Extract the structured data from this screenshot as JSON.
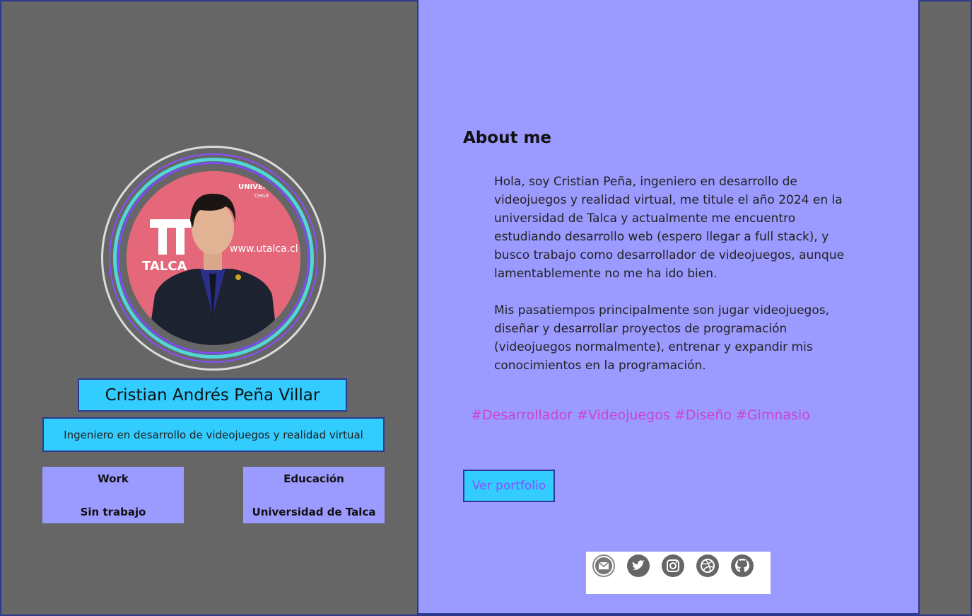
{
  "profile": {
    "name": "Cristian Andrés Peña Villar",
    "role": "Ingeniero en desarrollo de videojuegos y realidad virtual",
    "avatar_alt": "Cristian Peña"
  },
  "cards": {
    "work": {
      "label": "Work",
      "value": "Sin trabajo"
    },
    "education": {
      "label": "Educación",
      "value": "Universidad de Talca"
    }
  },
  "about": {
    "title": "About me",
    "paragraph1": "Hola, soy Cristian Peña, ingeniero en desarrollo de videojuegos y realidad virtual, me titule el año 2024 en la universidad de Talca y actualmente me encuentro estudiando desarrollo web (espero llegar a full stack), y busco trabajo como desarrollador de videojuegos, aunque lamentablemente no me ha ido bien.",
    "paragraph2": "Mis pasatiempos principalmente son jugar videojuegos, diseñar y desarrollar proyectos de programación (videojuegos normalmente), entrenar y expandir mis conocimientos en la programación.",
    "hashtags": "#Desarrollador #Videojuegos #Diseño #Gimnasio"
  },
  "actions": {
    "portfolio_label": "Ver portfolio"
  },
  "photo_background_text": {
    "url": "www.utalca.cl",
    "logo_top": "UNIVERSIDAD",
    "logo_sub": "CHILE",
    "logo_side": "TALCA"
  },
  "social": [
    "mail-icon",
    "twitter-icon",
    "instagram-icon",
    "dribbble-icon",
    "github-icon"
  ],
  "colors": {
    "page_bg": "#666666",
    "panel_bg": "#9a9aff",
    "accent_cyan": "#33ccff",
    "border": "#2b3a8f",
    "hashtag": "#cc44cc",
    "button_text": "#8a4dff"
  }
}
